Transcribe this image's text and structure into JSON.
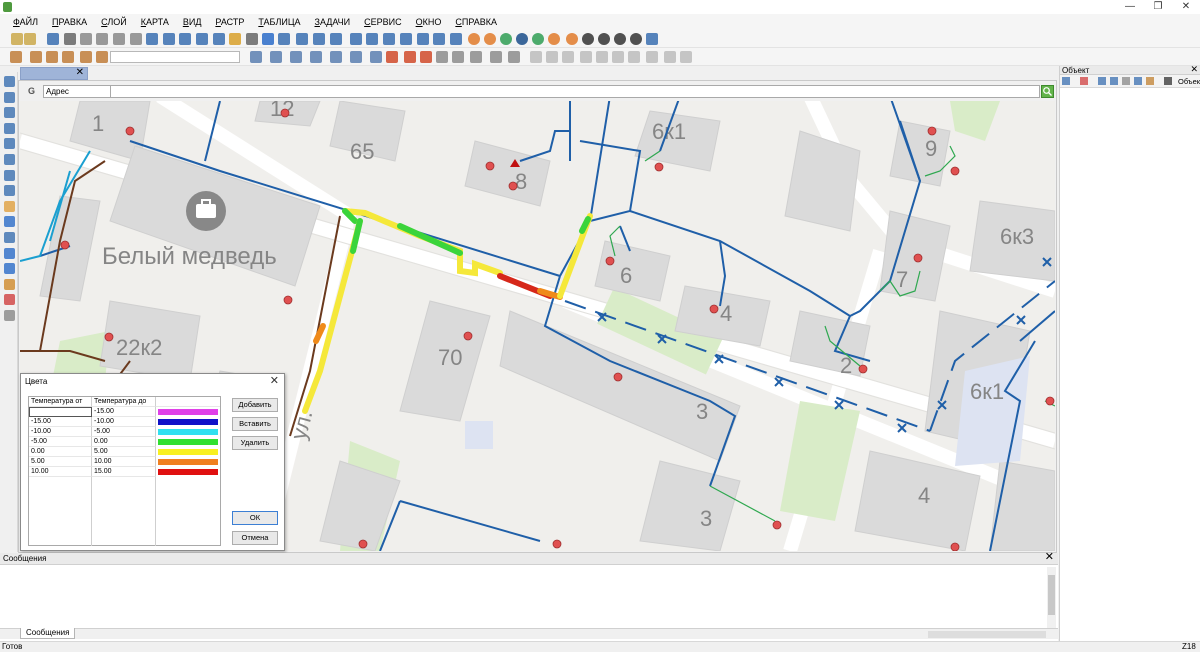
{
  "window": {
    "minimize": "—",
    "restore": "❐",
    "close": "✕"
  },
  "menu": [
    "Файл",
    "Правка",
    "Слой",
    "Карта",
    "Вид",
    "Растр",
    "Таблица",
    "Задачи",
    "Сервис",
    "Окно",
    "Справка"
  ],
  "map_tab": {
    "close": "✕"
  },
  "search": {
    "prefix": "G",
    "type": "Адрес"
  },
  "map": {
    "place_name": "Белый медведь",
    "street": "ул.",
    "buildings": [
      "1",
      "65",
      "8",
      "6к1",
      "9",
      "12",
      "6к3",
      "6",
      "7",
      "4",
      "2",
      "22к2",
      "70",
      "3",
      "6к1",
      "3",
      "4"
    ]
  },
  "colors_dialog": {
    "title": "Цвета",
    "close": "✕",
    "headers": [
      "Температура от",
      "Температура до"
    ],
    "rows": [
      {
        "from": "",
        "to": "-15.00",
        "color": "#e040e8"
      },
      {
        "from": "-15.00",
        "to": "-10.00",
        "color": "#1010c8"
      },
      {
        "from": "-10.00",
        "to": "-5.00",
        "color": "#30e0f0"
      },
      {
        "from": "-5.00",
        "to": "0.00",
        "color": "#30e030"
      },
      {
        "from": "0.00",
        "to": "5.00",
        "color": "#f8f020"
      },
      {
        "from": "5.00",
        "to": "10.00",
        "color": "#f08020"
      },
      {
        "from": "10.00",
        "to": "15.00",
        "color": "#e01010"
      }
    ],
    "buttons": {
      "add": "Добавить",
      "insert": "Вставить",
      "delete": "Удалить",
      "ok": "ОК",
      "cancel": "Отмена"
    }
  },
  "object_panel": {
    "title": "Объект",
    "label": "Объект",
    "close": "✕"
  },
  "messages": {
    "title": "Сообщения",
    "tab": "Сообщения",
    "close": "✕"
  },
  "status": {
    "text": "Готов",
    "zoom": "Z18"
  },
  "colors": {
    "pipe": "#1f5fa8",
    "lilac_pipe": "#6b3a1e",
    "accent_green": "#62b44a",
    "tab_blue": "#9fb4d8"
  }
}
